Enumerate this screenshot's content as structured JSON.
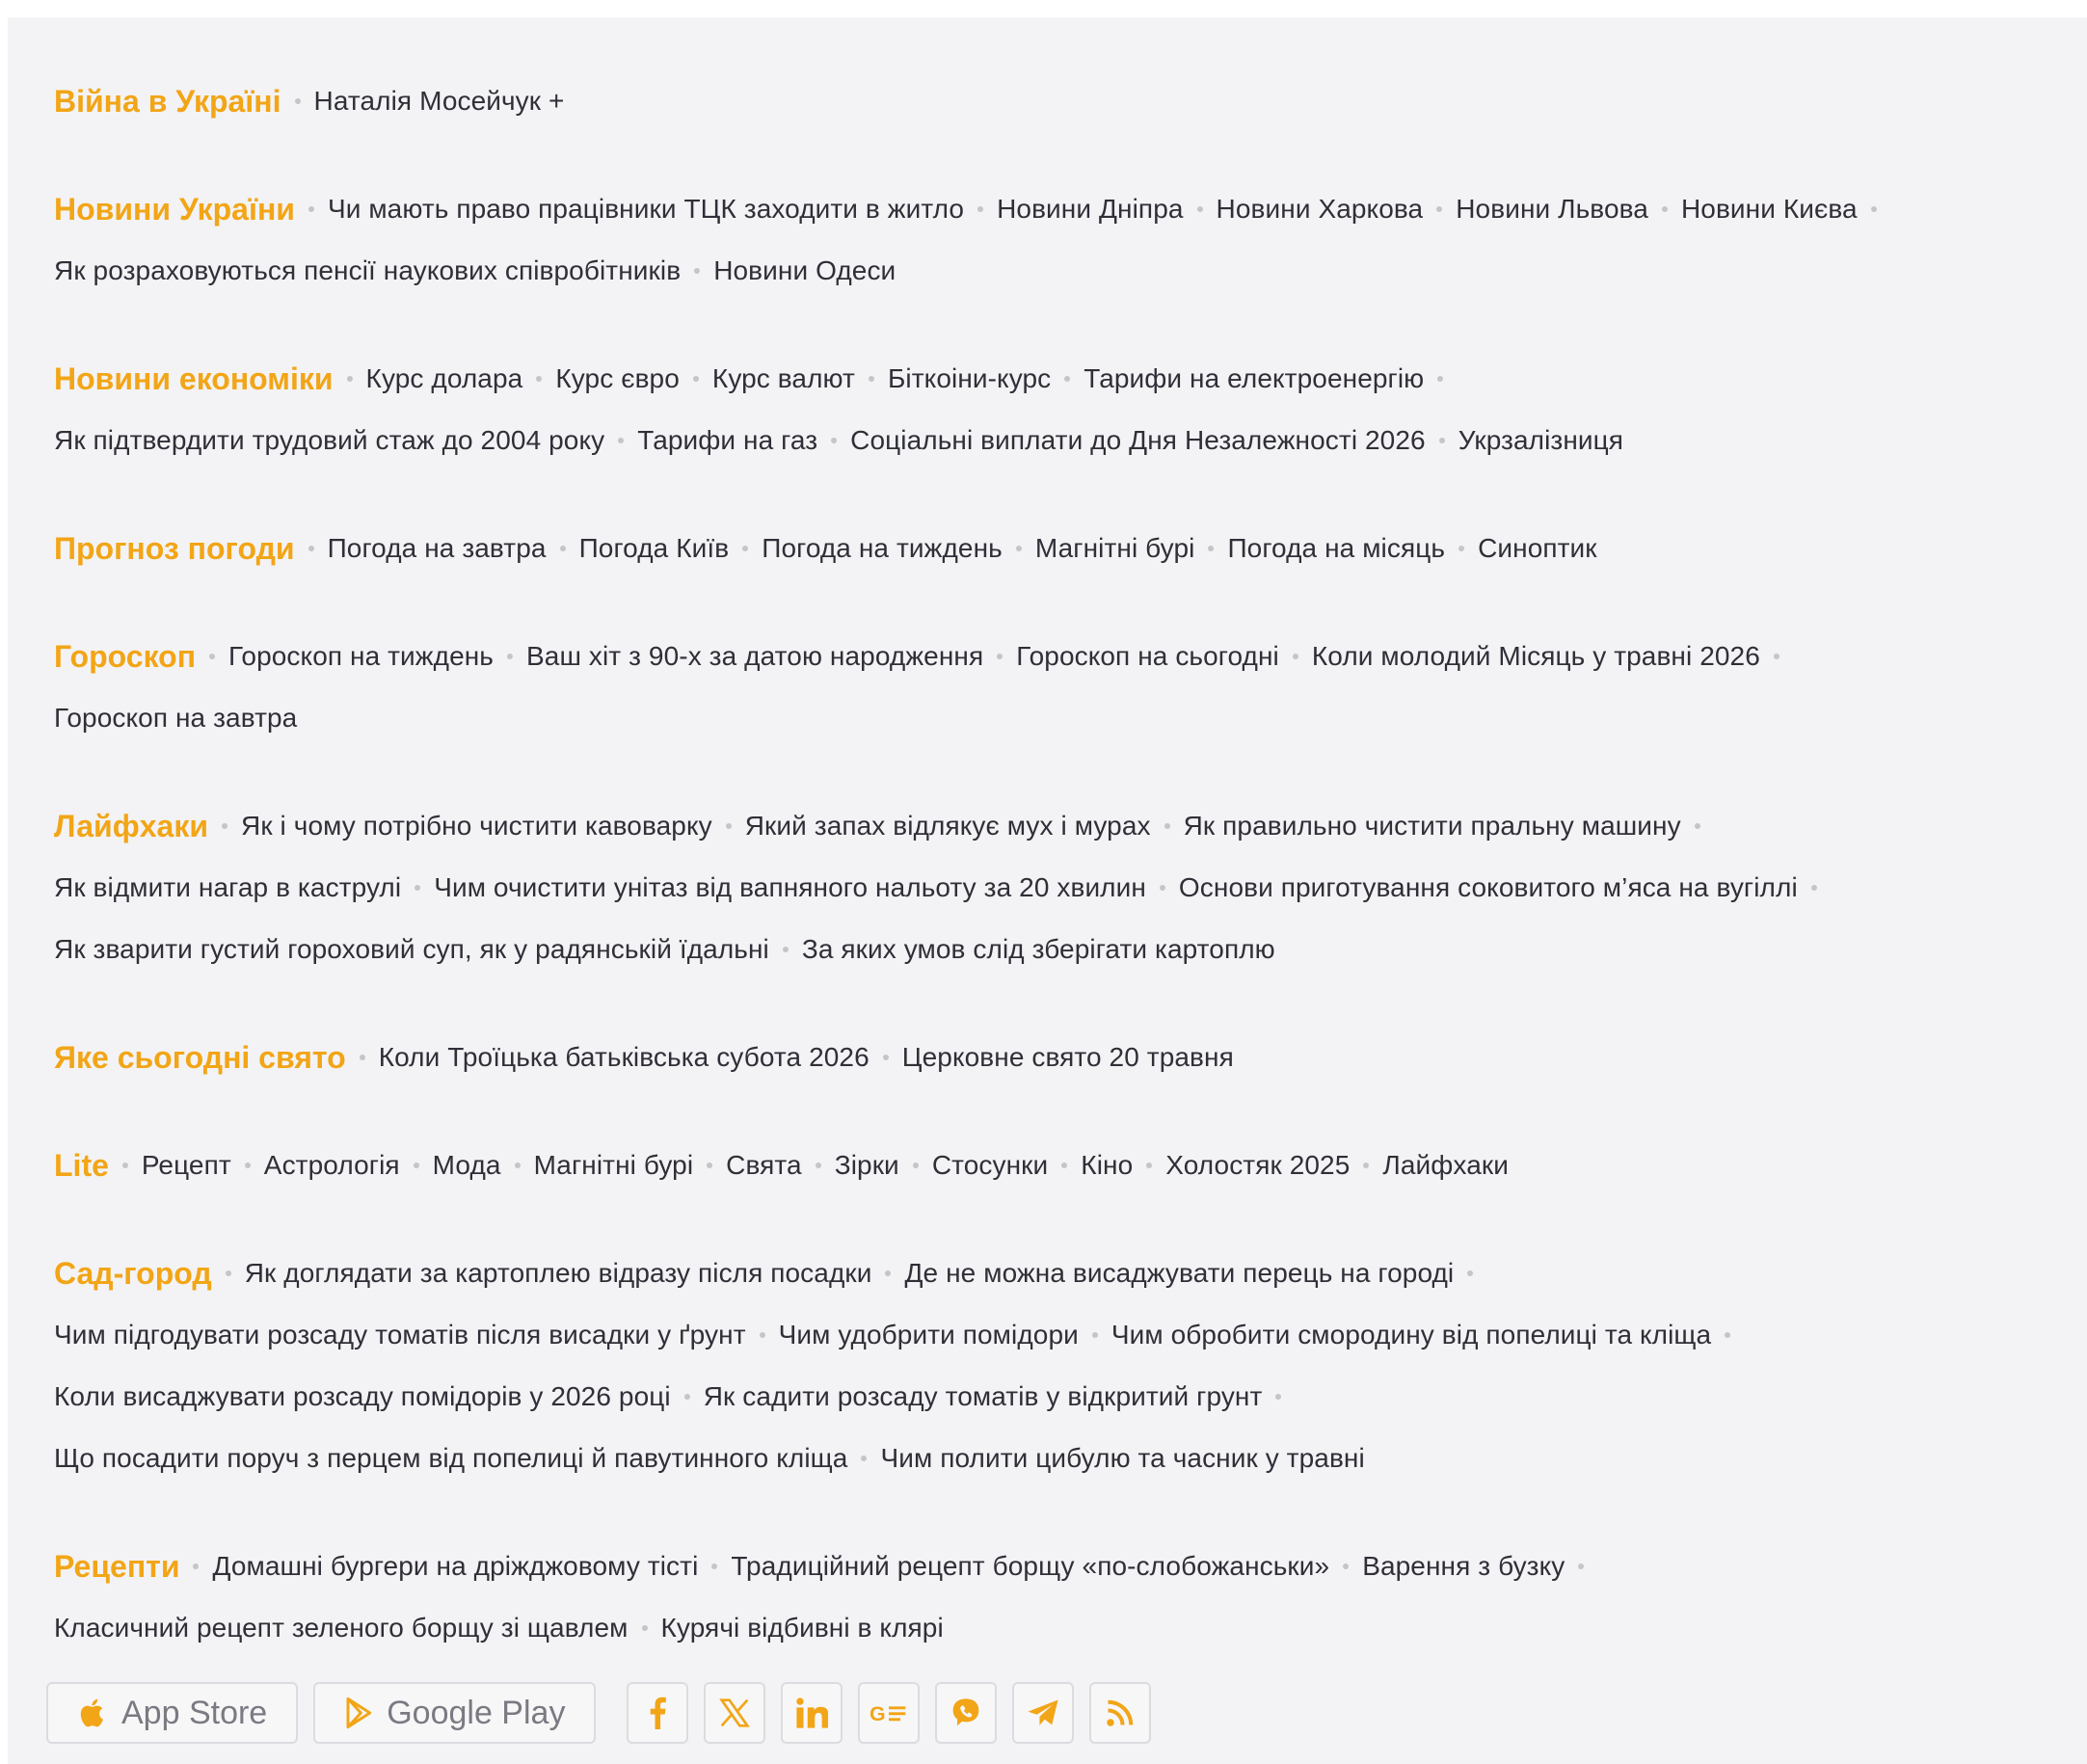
{
  "colors": {
    "accent": "#f2a516",
    "text": "#2f2f38",
    "background": "#f3f3f5"
  },
  "sections": [
    {
      "title": "Війна в Україні",
      "lines": [
        [
          "Наталія Мосейчук +"
        ]
      ]
    },
    {
      "title": "Новини України",
      "lines": [
        [
          "Чи мають право працівники ТЦК заходити в житло",
          "Новини Дніпра",
          "Новини Харкова",
          "Новини Львова",
          "Новини Києва"
        ],
        [
          "Як розраховуються пенсії наукових співробітників",
          "Новини Одеси"
        ]
      ]
    },
    {
      "title": "Новини економіки",
      "lines": [
        [
          "Курс долара",
          "Курс євро",
          "Курс валют",
          "Біткоіни-курс",
          "Тарифи на електроенергію"
        ],
        [
          "Як підтвердити трудовий стаж до 2004 року",
          "Тарифи на газ",
          "Соціальні виплати до Дня Незалежності 2026",
          "Укрзалізниця"
        ]
      ]
    },
    {
      "title": "Прогноз погоди",
      "lines": [
        [
          "Погода на завтра",
          "Погода Київ",
          "Погода на тиждень",
          "Магнітні бурі",
          "Погода на місяць",
          "Синоптик"
        ]
      ]
    },
    {
      "title": "Гороскоп",
      "lines": [
        [
          "Гороскоп на тиждень",
          "Ваш хіт з 90-х за датою народження",
          "Гороскоп на сьогодні",
          "Коли молодий Місяць у травні 2026"
        ],
        [
          "Гороскоп на завтра"
        ]
      ]
    },
    {
      "title": "Лайфхаки",
      "lines": [
        [
          "Як і чому потрібно чистити кавоварку",
          "Який запах відлякує мух і мурах",
          "Як правильно чистити пральну машину"
        ],
        [
          "Як відмити нагар в каструлі",
          "Чим очистити унітаз від вапняного нальоту за 20 хвилин",
          "Основи приготування соковитого м’яса на вугіллі"
        ],
        [
          "Як зварити густий гороховий суп, як у радянській їдальні",
          "За яких умов слід зберігати картоплю"
        ]
      ]
    },
    {
      "title": "Яке сьогодні свято",
      "lines": [
        [
          "Коли Троїцька батьківська субота 2026",
          "Церковне свято 20 травня"
        ]
      ]
    },
    {
      "title": "Lite",
      "lines": [
        [
          "Рецепт",
          "Астрологія",
          "Мода",
          "Магнітні бурі",
          "Свята",
          "Зірки",
          "Стосунки",
          "Кіно",
          "Холостяк 2025",
          "Лайфхаки"
        ]
      ]
    },
    {
      "title": "Сад-город",
      "lines": [
        [
          "Як доглядати за картоплею відразу після посадки",
          "Де не можна висаджувати перець на городі"
        ],
        [
          "Чим підгодувати розсаду томатів після висадки у ґрунт",
          "Чим удобрити помідори",
          "Чим обробити смородину від попелиці та кліща"
        ],
        [
          "Коли висаджувати розсаду помідорів у 2026 році",
          "Як садити розсаду томатів у відкритий грунт"
        ],
        [
          "Що посадити поруч з перцем від попелиці й павутинного кліща",
          "Чим полити цибулю та часник у травні"
        ]
      ]
    },
    {
      "title": "Рецепти",
      "lines": [
        [
          "Домашні бургери на дріжджовому тісті",
          "Традиційний рецепт борщу «по-слобожанськи»",
          "Варення з бузку"
        ],
        [
          "Класичний рецепт зеленого борщу зі щавлем",
          "Курячі відбивні в клярі"
        ]
      ]
    }
  ],
  "footer": {
    "app_store": {
      "label": "App Store",
      "icon": "apple-icon"
    },
    "google_play": {
      "label": "Google Play",
      "icon": "google-play-icon"
    },
    "social": [
      "facebook-icon",
      "x-icon",
      "linkedin-icon",
      "google-news-icon",
      "viber-icon",
      "telegram-icon",
      "rss-icon"
    ]
  }
}
